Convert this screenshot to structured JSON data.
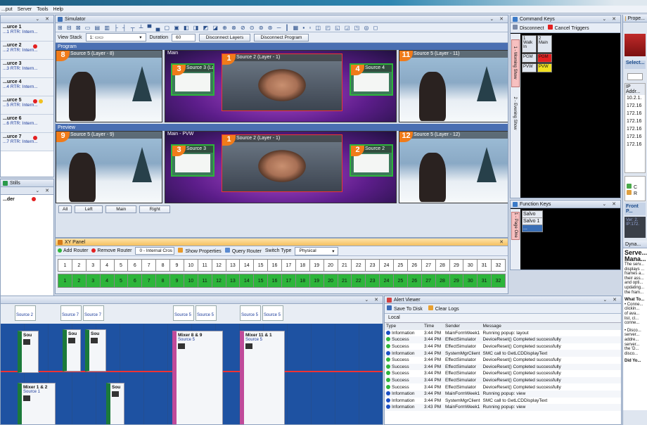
{
  "menu": [
    "...put",
    "Server",
    "Tools",
    "Help"
  ],
  "left": {
    "sources": [
      {
        "name": "...urce 1",
        "sub": "...1 RTR: Intern..."
      },
      {
        "name": "...urce 2",
        "sub": "...2 RTR: Intern..."
      },
      {
        "name": "...urce 3",
        "sub": "...3 RTR: Intern..."
      },
      {
        "name": "...urce 4",
        "sub": "...4 RTR: Intern..."
      },
      {
        "name": "...urce 5",
        "sub": "...5 RTR: Intern..."
      },
      {
        "name": "...urce 6",
        "sub": "...6 RTR: Intern..."
      },
      {
        "name": "...urce 7",
        "sub": "...7 RTR: Intern..."
      }
    ],
    "stills_tab": "Stills",
    "stills_item": "...der"
  },
  "sim": {
    "title": "Simulator",
    "view_stack_label": "View Stack",
    "view_stack_value": "1:",
    "duration_label": "Duration",
    "duration_value": "60",
    "disconnect_layers": "Disconnect Layers",
    "disconnect_program": "Disconnect Program",
    "program_label": "Program",
    "preview_label": "Preview",
    "program": {
      "left": {
        "num": "8",
        "label": "Source 5 (Layer - 8)"
      },
      "main": "Main",
      "center": {
        "num": "1",
        "label": "Source 2 (Layer - 1)"
      },
      "small_left": {
        "num": "3",
        "label": "Source 3 (Layer - 3)"
      },
      "small_right": {
        "num": "4",
        "label": "Source 4"
      },
      "right": {
        "num": "11",
        "label": "Source 5 (Layer - 11)"
      }
    },
    "preview": {
      "left": {
        "num": "9",
        "label": "Source 5 (Layer - 9)"
      },
      "main": "Main - PVW",
      "center": {
        "num": "1",
        "label": "Source 2 (Layer - 1)"
      },
      "small_left": {
        "num": "3",
        "label": "Source 3"
      },
      "small_right": {
        "num": "2",
        "label": "Source 2"
      },
      "right": {
        "num": "12",
        "label": "Source 5 (Layer - 12)"
      }
    },
    "buttons": [
      "All",
      "Left",
      "Main",
      "Right"
    ]
  },
  "xy": {
    "title": "XY Panel",
    "add_router": "Add Router",
    "remove_router": "Remove Router",
    "router_value": "0 - Internal Cros",
    "show_props": "Show Properties",
    "query_router": "Query Router",
    "switch_type_label": "Switch Type",
    "switch_type_value": "Physical",
    "numbers": [
      "1",
      "2",
      "3",
      "4",
      "5",
      "6",
      "7",
      "8",
      "9",
      "10",
      "11",
      "12",
      "13",
      "14",
      "15",
      "16",
      "17",
      "18",
      "19",
      "20",
      "21",
      "22",
      "23",
      "24",
      "25",
      "26",
      "27",
      "28",
      "29",
      "30",
      "31",
      "32"
    ]
  },
  "cmd": {
    "title": "Command Keys",
    "disconnect": "Disconnect",
    "cancel_triggers": "Cancel Triggers",
    "keys": [
      {
        "num": "1",
        "label": "Walk In"
      },
      {
        "num": "2",
        "label": "Main"
      },
      {
        "label": "PGM"
      },
      {
        "label": "PGM"
      },
      {
        "label": "PVW"
      },
      {
        "label": "PVW"
      }
    ],
    "tabs": [
      "1 - Morning Show",
      "2 - Evening Show"
    ]
  },
  "fk": {
    "title": "Function Keys",
    "items": [
      "Salvo",
      "Salvo 1",
      "..."
    ],
    "tab": "1 - Page One"
  },
  "right": {
    "title": "Prope...",
    "select": "Select...",
    "ip_header": "IP Addr...",
    "ips": [
      "10.2.1.",
      "172.16",
      "172.16",
      "172.16",
      "172.16",
      "172.16",
      "172.16"
    ],
    "front": "Front P...",
    "ver": "Ver: 2.",
    "ipline": "IP:172.",
    "dyn": "Dyna...",
    "heading": "Serve... Mana...",
    "para": [
      "The serv...",
      "displays ...",
      "frames a...",
      "their ass...",
      "and opti...",
      "updating...",
      "the fram..."
    ],
    "what": "What To...",
    "b1": [
      "• Conne...",
      "clickin...",
      "of ava...",
      "list, cl...",
      "conne..."
    ],
    "b2": [
      "• Disco...",
      "server...",
      "addre...",
      "server...",
      "the 'D...",
      "disco..."
    ],
    "did": "Did Yo..."
  },
  "timeline": {
    "tiles": [
      "Source 2",
      "Source 7",
      "Source 7",
      "Source 5",
      "Source 5",
      "Source 5",
      "Source 5"
    ],
    "strips": [
      "Sou",
      "Sou",
      "Sou",
      "Mixer 8 & 9",
      "Mixer 11 & 1",
      "Mixer 1 & 2",
      "Sou"
    ],
    "strip_subs": [
      "Source 5",
      "Source 5",
      "Source 1"
    ]
  },
  "alert": {
    "title": "Alert Viewer",
    "save": "Save To Disk",
    "clear": "Clear Logs",
    "tab": "Local",
    "headers": [
      "Type",
      "Time",
      "Sender",
      "Message"
    ],
    "rows": [
      [
        "Information",
        "3:44 PM",
        "MainFormWeek1",
        "Running popup: layout",
        "info"
      ],
      [
        "Success",
        "3:44 PM",
        "EffectSimulator",
        "DeviceReset() Completed successfully",
        "ok"
      ],
      [
        "Success",
        "3:44 PM",
        "EffectSimulator",
        "DeviceReset() Completed successfully",
        "ok"
      ],
      [
        "Information",
        "3:44 PM",
        "SystemMgrClient",
        "SMC call to GetLCDDisplayText",
        "info"
      ],
      [
        "Success",
        "3:44 PM",
        "EffectSimulator",
        "DeviceReset() Completed successfully",
        "ok"
      ],
      [
        "Success",
        "3:44 PM",
        "EffectSimulator",
        "DeviceReset() Completed successfully",
        "ok"
      ],
      [
        "Success",
        "3:44 PM",
        "EffectSimulator",
        "DeviceReset() Completed successfully",
        "ok"
      ],
      [
        "Success",
        "3:44 PM",
        "EffectSimulator",
        "DeviceReset() Completed successfully",
        "ok"
      ],
      [
        "Success",
        "3:44 PM",
        "EffectSimulator",
        "DeviceReset() Completed successfully",
        "ok"
      ],
      [
        "Information",
        "3:44 PM",
        "MainFormWeek1",
        "Running popup: view",
        "info"
      ],
      [
        "Information",
        "3:44 PM",
        "SystemMgrClient",
        "SMC call to GetLCDDisplayText",
        "info"
      ],
      [
        "Information",
        "3:43 PM",
        "MainFormWeek1",
        "Running popup: view",
        "info"
      ]
    ]
  },
  "colors": {
    "orange": "#f07b1a",
    "green": "#2db53b",
    "red": "#e32020",
    "blue": "#1a4ec2"
  }
}
